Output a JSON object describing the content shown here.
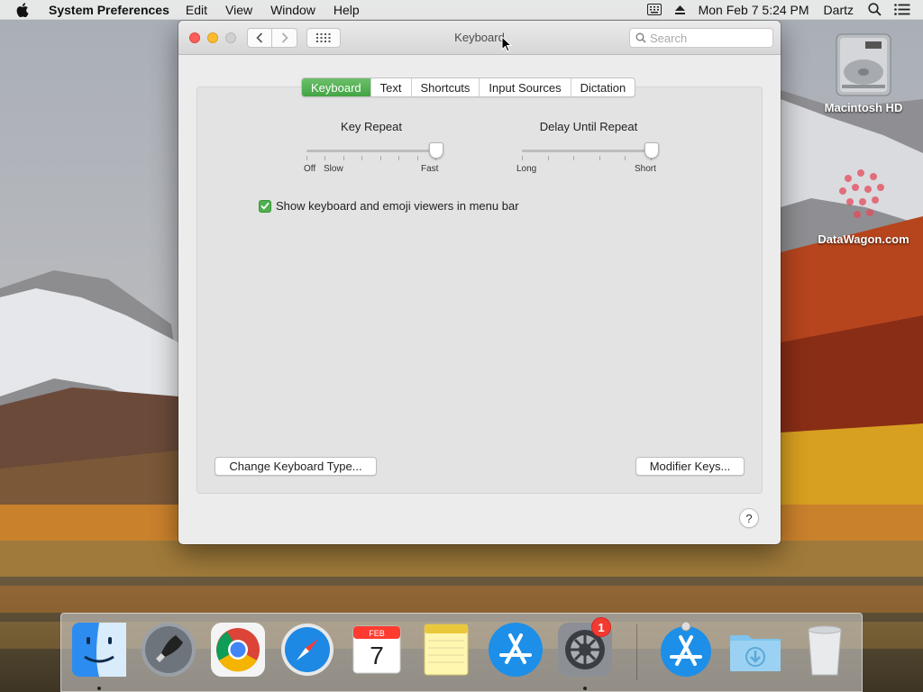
{
  "menubar": {
    "app_name": "System Preferences",
    "menus": [
      "Edit",
      "View",
      "Window",
      "Help"
    ],
    "clock": "Mon Feb 7  5:24 PM",
    "user": "Dartz"
  },
  "desktop": {
    "hd_label": "Macintosh HD",
    "watermark_label": "DataWagon.com"
  },
  "window": {
    "title": "Keyboard",
    "search_placeholder": "Search",
    "tabs": [
      {
        "label": "Keyboard",
        "active": true
      },
      {
        "label": "Text",
        "active": false
      },
      {
        "label": "Shortcuts",
        "active": false
      },
      {
        "label": "Input Sources",
        "active": false
      },
      {
        "label": "Dictation",
        "active": false
      }
    ],
    "key_repeat": {
      "title": "Key Repeat",
      "label_off": "Off",
      "label_slow": "Slow",
      "label_fast": "Fast",
      "value_fraction": 1.0
    },
    "delay_until_repeat": {
      "title": "Delay Until Repeat",
      "label_long": "Long",
      "label_short": "Short",
      "value_fraction": 1.0
    },
    "show_viewers_checkbox": {
      "label": "Show keyboard and emoji viewers in menu bar",
      "checked": true
    },
    "change_keyboard_button": "Change Keyboard Type...",
    "modifier_keys_button": "Modifier Keys...",
    "help_button": "?"
  },
  "dock": {
    "calendar_month": "FEB",
    "calendar_day": "7",
    "system_prefs_badge": "1"
  },
  "colors": {
    "accent_green": "#43a443",
    "close": "#fc5f57",
    "minimize": "#fdbc2e",
    "badge_red": "#f23b30"
  }
}
